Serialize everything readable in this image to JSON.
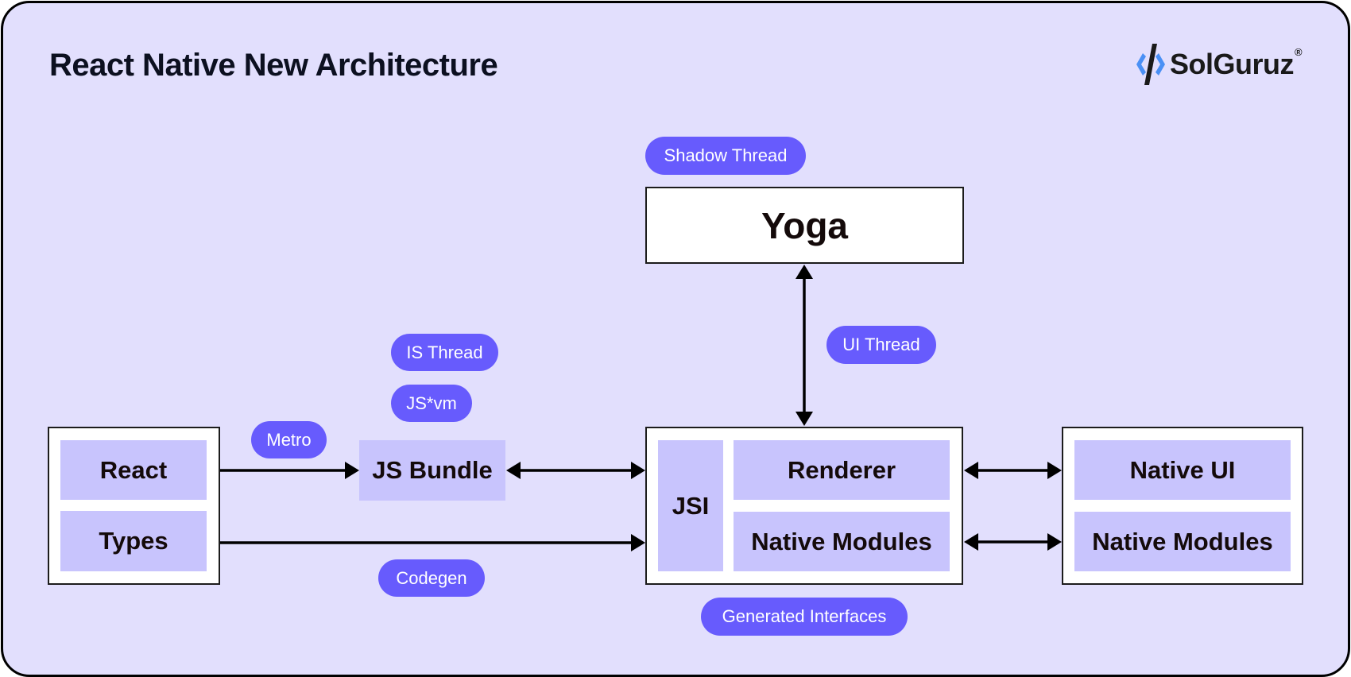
{
  "title": "React Native New Architecture",
  "logo": {
    "name": "SolGuruz",
    "registered": "®",
    "icon": "solguruz-logo-icon"
  },
  "colors": {
    "background": "#E2DFFD",
    "pill": "#675BFD",
    "cell": "#C8C4FD",
    "logo_accent": "#4A90F5"
  },
  "labels": {
    "shadow_thread": "Shadow Thread",
    "ui_thread": "UI Thread",
    "is_thread": "IS Thread",
    "js_vm": "JS*vm",
    "metro": "Metro",
    "codegen": "Codegen",
    "generated_interfaces": "Generated Interfaces"
  },
  "nodes": {
    "yoga": "Yoga",
    "react": "React",
    "types": "Types",
    "js_bundle": "JS Bundle",
    "jsi": "JSI",
    "renderer": "Renderer",
    "native_modules_core": "Native Modules",
    "native_ui": "Native UI",
    "native_modules_platform": "Native Modules"
  },
  "edges": [
    {
      "from": "React",
      "to": "JS Bundle",
      "direction": "one-way"
    },
    {
      "from": "JS Bundle",
      "to": "JSI",
      "direction": "two-way"
    },
    {
      "from": "Types",
      "to": "JSI",
      "direction": "one-way"
    },
    {
      "from": "Yoga",
      "to": "JSI",
      "direction": "two-way"
    },
    {
      "from": "Renderer",
      "to": "Native UI",
      "direction": "two-way"
    },
    {
      "from": "Native Modules",
      "to": "Native Modules",
      "direction": "two-way"
    }
  ]
}
